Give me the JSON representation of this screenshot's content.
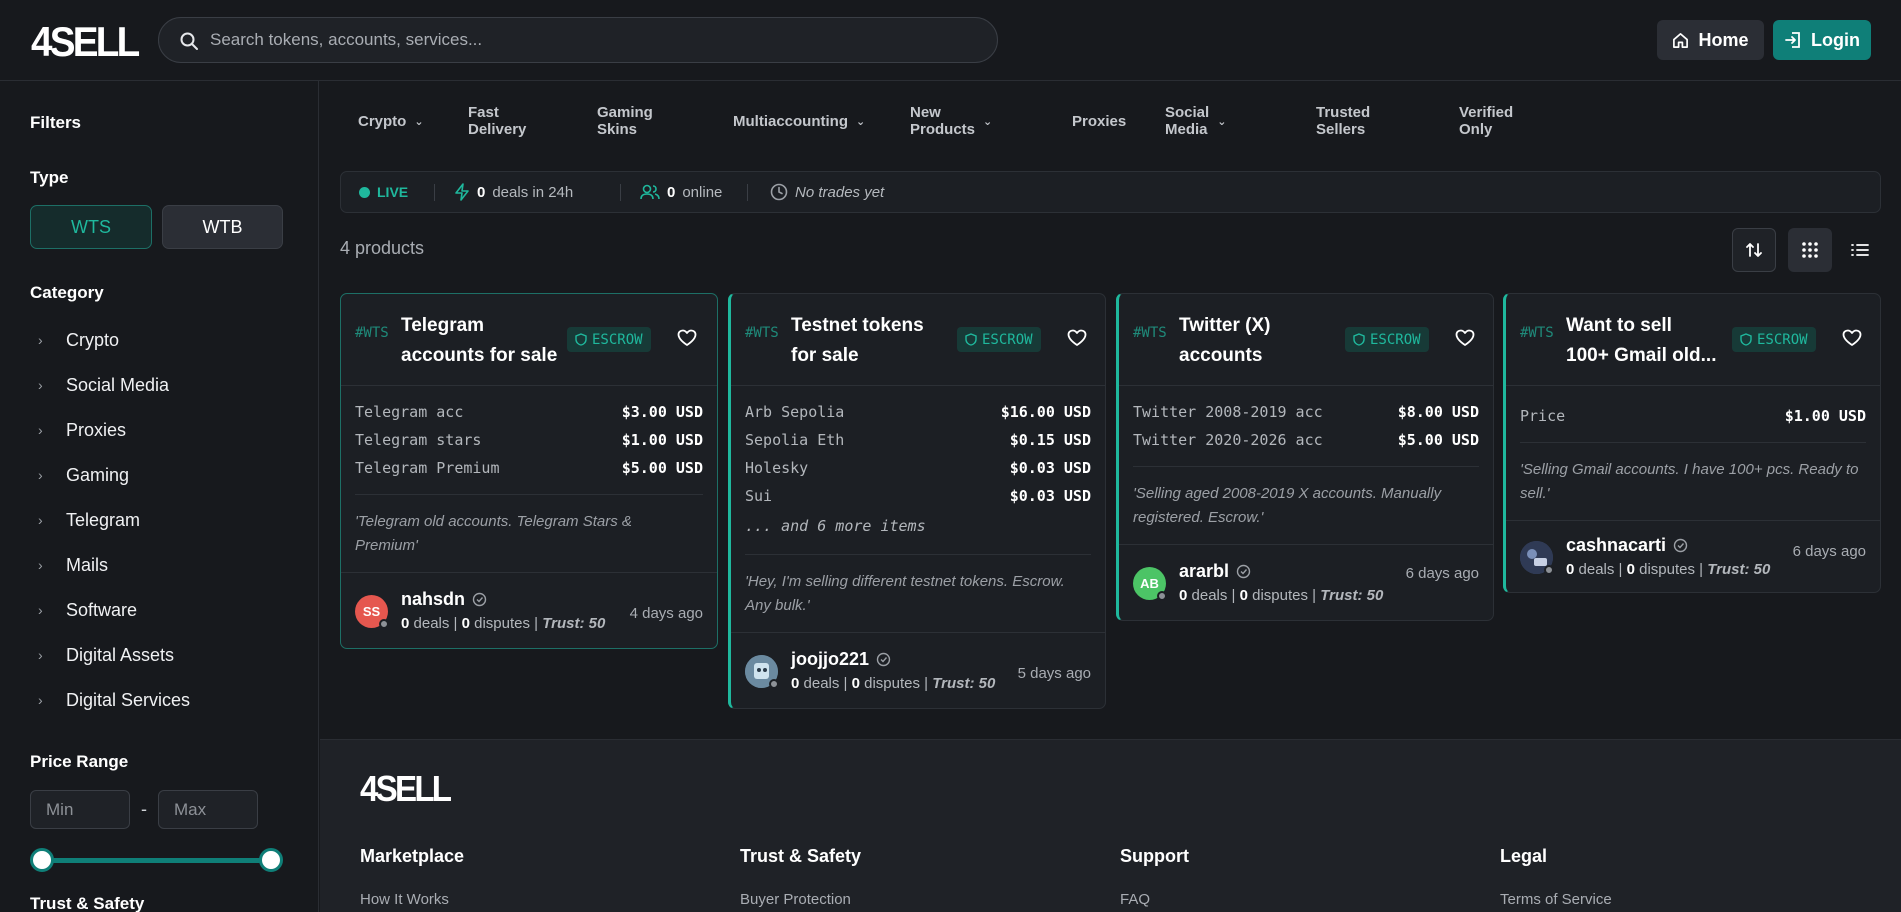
{
  "header": {
    "logo": "4SELL",
    "search_placeholder": "Search tokens, accounts, services...",
    "home_label": "Home",
    "login_label": "Login"
  },
  "sidebar": {
    "filters_title": "Filters",
    "type_title": "Type",
    "type_wts": "WTS",
    "type_wtb": "WTB",
    "category_title": "Category",
    "categories": [
      "Crypto",
      "Social Media",
      "Proxies",
      "Gaming",
      "Telegram",
      "Mails",
      "Software",
      "Digital Assets",
      "Digital Services"
    ],
    "price_title": "Price Range",
    "min_placeholder": "Min",
    "max_placeholder": "Max",
    "price_dash": "-",
    "trust_title": "Trust & Safety"
  },
  "tabs": [
    "Crypto",
    "Fast Delivery",
    "Gaming Skins",
    "Multiaccounting",
    "New Products",
    "Proxies",
    "Social Media",
    "Trusted Sellers",
    "Verified Only"
  ],
  "live": {
    "label": "LIVE",
    "deals_count": "0",
    "deals_text": "deals in 24h",
    "online_count": "0",
    "online_text": "online",
    "last_trade": "No trades yet"
  },
  "products_count": "4 products",
  "colors": {
    "accent": "#1fb89d",
    "accent_dark": "#0f7f78",
    "bg": "#17191d",
    "card": "#1c1f24"
  },
  "cards": [
    {
      "tag": "#WTS",
      "title_line1": "Telegram",
      "title_line2": "accounts for sale",
      "escrow": "ESCROW",
      "items": [
        {
          "name": "Telegram acc",
          "price": "$3.00 USD"
        },
        {
          "name": "Telegram stars",
          "price": "$1.00 USD"
        },
        {
          "name": "Telegram Premium",
          "price": "$5.00 USD"
        }
      ],
      "more": "",
      "desc_line1": "'Telegram old accounts. Telegram Stars &",
      "desc_line2": "Premium'",
      "seller": "nahsdn",
      "avatar_initials": "SS",
      "deals": "0",
      "deals_label": "deals",
      "disputes": "0",
      "disputes_label": "disputes",
      "trust": "Trust: 50",
      "time": "4 days ago"
    },
    {
      "tag": "#WTS",
      "title_line1": "Testnet tokens",
      "title_line2": "for sale",
      "escrow": "ESCROW",
      "items": [
        {
          "name": "Arb Sepolia",
          "price": "$16.00 USD"
        },
        {
          "name": "Sepolia Eth",
          "price": "$0.15 USD"
        },
        {
          "name": "Holesky",
          "price": "$0.03 USD"
        },
        {
          "name": "Sui",
          "price": "$0.03 USD"
        }
      ],
      "more": "... and 6 more items",
      "desc_line1": "'Hey, I'm selling different testnet tokens. Escrow.",
      "desc_line2": "Any bulk.'",
      "seller": "joojjo221",
      "avatar_initials": "",
      "deals": "0",
      "deals_label": "deals",
      "disputes": "0",
      "disputes_label": "disputes",
      "trust": "Trust: 50",
      "time": "5 days ago"
    },
    {
      "tag": "#WTS",
      "title_line1": "Twitter (X)",
      "title_line2": "accounts",
      "escrow": "ESCROW",
      "items": [
        {
          "name": "Twitter 2008-2019 acc",
          "price": "$8.00 USD"
        },
        {
          "name": "Twitter 2020-2026 acc",
          "price": "$5.00 USD"
        }
      ],
      "more": "",
      "desc_line1": "'Selling aged 2008-2019 X accounts. Manually",
      "desc_line2": "registered. Escrow.'",
      "seller": "ararbl",
      "avatar_initials": "AB",
      "deals": "0",
      "deals_label": "deals",
      "disputes": "0",
      "disputes_label": "disputes",
      "trust": "Trust: 50",
      "time": "6 days ago"
    },
    {
      "tag": "#WTS",
      "title_line1": "Want to sell",
      "title_line2": "100+ Gmail old...",
      "escrow": "ESCROW",
      "items": [
        {
          "name": "Price",
          "price": "$1.00 USD"
        }
      ],
      "more": "",
      "desc_line1": "'Selling Gmail accounts. I have 100+ pcs. Ready to",
      "desc_line2": "sell.'",
      "seller": "cashnacarti",
      "avatar_initials": "",
      "deals": "0",
      "deals_label": "deals",
      "disputes": "0",
      "disputes_label": "disputes",
      "trust": "Trust: 50",
      "time": "6 days ago"
    }
  ],
  "footer": {
    "logo": "4SELL",
    "columns": [
      {
        "title": "Marketplace",
        "link": "How It Works"
      },
      {
        "title": "Trust & Safety",
        "link": "Buyer Protection"
      },
      {
        "title": "Support",
        "link": "FAQ"
      },
      {
        "title": "Legal",
        "link": "Terms of Service"
      }
    ]
  }
}
